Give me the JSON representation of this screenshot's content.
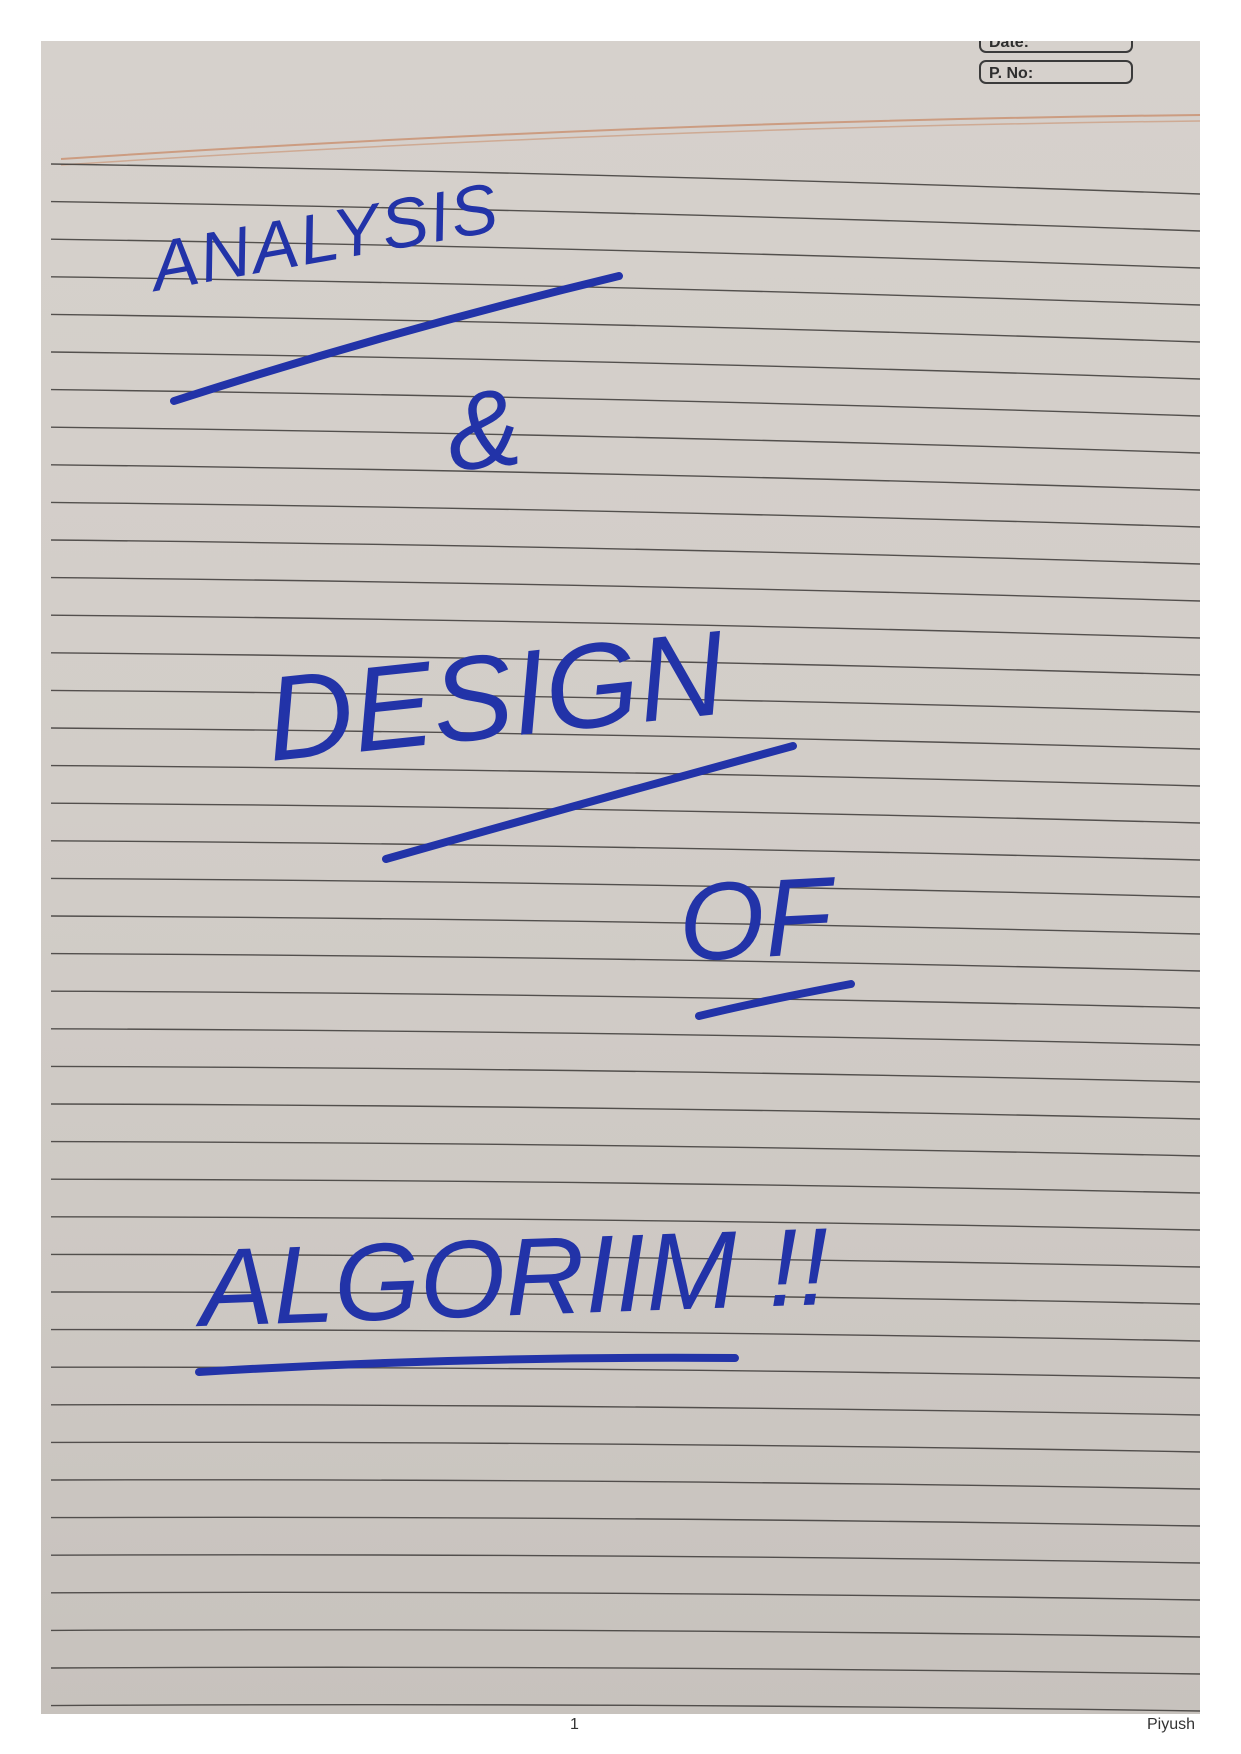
{
  "header": {
    "date_label": "Date:",
    "page_no_label": "P. No:"
  },
  "title_lines": {
    "line1": "ANALYSIS",
    "line2": "&",
    "line3": "DESIGN",
    "line4": "OF",
    "line5": "ALGORIIM !!"
  },
  "footer": {
    "page_number": "1",
    "author": "Piyush"
  },
  "colors": {
    "ink": "#2233a8",
    "paper": "#d3cec9",
    "rule": "#3a3a3a"
  }
}
